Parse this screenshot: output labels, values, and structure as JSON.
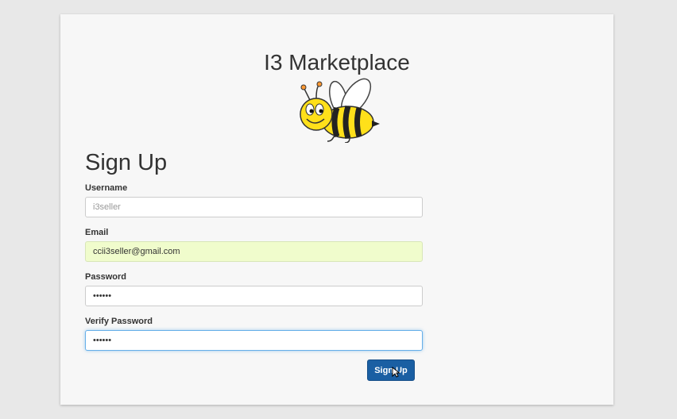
{
  "header": {
    "brand_title": "I3 Marketplace"
  },
  "form": {
    "title": "Sign Up",
    "username": {
      "label": "Username",
      "value": "",
      "placeholder": "i3seller"
    },
    "email": {
      "label": "Email",
      "value": "ccii3seller@gmail.com",
      "placeholder": ""
    },
    "password": {
      "label": "Password",
      "value": "aaaaaa",
      "placeholder": ""
    },
    "verify_password": {
      "label": "Verify Password",
      "value": "aaaaaa",
      "placeholder": ""
    },
    "submit_label": "Sign Up"
  },
  "colors": {
    "page_background": "#e8e8e8",
    "panel_background": "#f7f7f7",
    "primary_button": "#1a5fa3",
    "autofill_background": "#f0fccc",
    "focus_ring": "#66afe9"
  },
  "icons": {
    "mascot": "bee-icon",
    "pointer": "mouse-cursor-icon"
  }
}
